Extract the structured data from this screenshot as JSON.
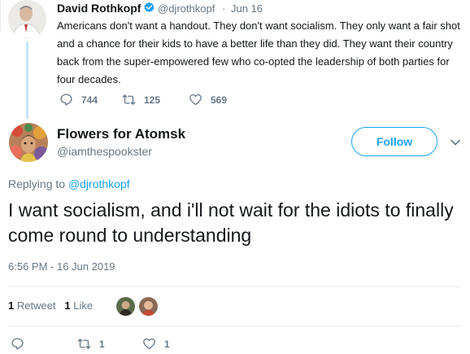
{
  "parent_tweet": {
    "name": "David Rothkopf",
    "handle": "@djrothkopf",
    "separator": "·",
    "date": "Jun 16",
    "text": "Americans don't want a handout.  They don't want socialism.  They only want a fair shot and a chance for their kids to have a better life than they did.  They want their country back from the super-empowered few who co-opted the leadership of both parties for four decades.",
    "replies": "744",
    "retweets": "125",
    "likes": "569",
    "verified_icon": "verified-badge-icon"
  },
  "main_tweet": {
    "name": "Flowers for Atomsk",
    "handle": "@iamthespookster",
    "follow_label": "Follow",
    "replying_prefix": "Replying to",
    "replying_to": "@djrothkopf",
    "text": "I want socialism, and i'll not wait for the idiots to finally come round to understanding",
    "timestamp": "6:56 PM - 16 Jun 2019",
    "retweet_count": "1",
    "retweet_label": "Retweet",
    "like_count": "1",
    "like_label": "Like",
    "action_retweets": "1",
    "action_likes": "1"
  },
  "colors": {
    "accent": "#1da1f2",
    "muted": "#657786",
    "text": "#14171a",
    "thread_line": "#c4e4f7"
  }
}
